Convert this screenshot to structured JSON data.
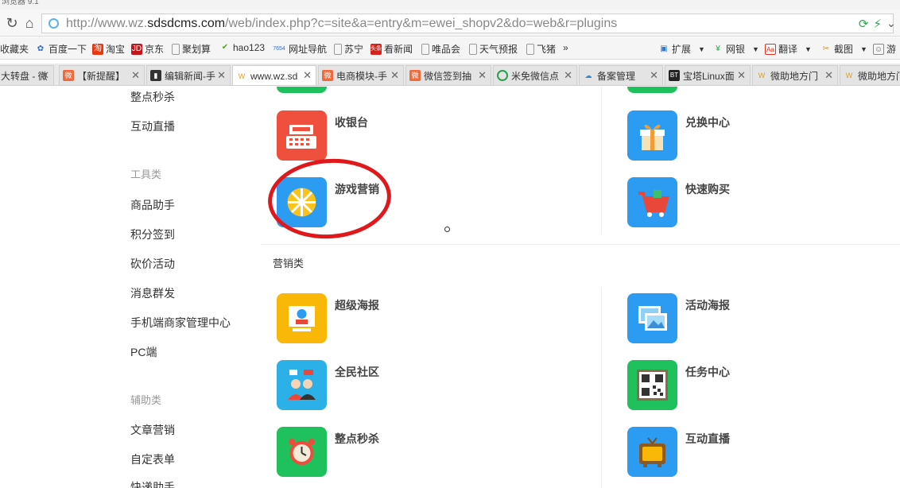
{
  "window": {
    "title": "浏览器 9.1"
  },
  "toolbar": {
    "refresh_label": "↻",
    "home_label": "⌂"
  },
  "address": {
    "pre": "http://www.wz.",
    "domain": "sdsdcms.com",
    "path": "/web/index.php?c=site&a=entry&m=ewei_shopv2&do=web&r=plugins"
  },
  "bookmarks": [
    {
      "label": "收藏夹",
      "icon": "star-icon"
    },
    {
      "label": "百度一下",
      "icon": "baidu-icon"
    },
    {
      "label": "淘宝",
      "icon": "taobao-icon"
    },
    {
      "label": "京东",
      "icon": "jd-icon"
    },
    {
      "label": "聚划算",
      "icon": "page-icon"
    },
    {
      "label": "hao123",
      "icon": "hao123-icon"
    },
    {
      "label": "网址导航",
      "icon": "nav-icon"
    },
    {
      "label": "苏宁",
      "icon": "page-icon"
    },
    {
      "label": "看新闻",
      "icon": "news-icon"
    },
    {
      "label": "唯品会",
      "icon": "page-icon"
    },
    {
      "label": "天气预报",
      "icon": "page-icon"
    },
    {
      "label": "飞猪",
      "icon": "page-icon"
    },
    {
      "label": "»",
      "icon": ""
    }
  ],
  "extensions": [
    {
      "label": "扩展",
      "icon": "puzzle-icon"
    },
    {
      "label": "网银",
      "icon": "bank-icon"
    },
    {
      "label": "翻译",
      "icon": "translate-icon"
    },
    {
      "label": "截图",
      "icon": "scissors-icon"
    },
    {
      "label": "游",
      "icon": "game-icon"
    }
  ],
  "tabs": [
    {
      "label": "大转盘 - 微",
      "icon": "page-icon"
    },
    {
      "label": "【新提醒】",
      "icon": "weiqing-icon"
    },
    {
      "label": "编辑新闻-手",
      "icon": "editor-icon"
    },
    {
      "label": "www.wz.sd",
      "icon": "site-icon"
    },
    {
      "label": "电商模块-手",
      "icon": "weiqing-icon"
    },
    {
      "label": "微信签到抽",
      "icon": "weiqing-icon"
    },
    {
      "label": "米免微信点",
      "icon": "check-icon"
    },
    {
      "label": "备案管理",
      "icon": "cloud-icon"
    },
    {
      "label": "宝塔Linux面",
      "icon": "bt-icon"
    },
    {
      "label": "微助地方门",
      "icon": "site-icon"
    },
    {
      "label": "微助地方门",
      "icon": "site-icon"
    }
  ],
  "sidebar": {
    "items_top": [
      "整点秒杀",
      "互动直播"
    ],
    "tools_header": "工具类",
    "tools": [
      "商品助手",
      "积分签到",
      "砍价活动",
      "消息群发",
      "手机端商家管理中心",
      "PC端"
    ],
    "aux_header": "辅助类",
    "aux": [
      "文章营销",
      "自定表单",
      "快递助手"
    ]
  },
  "section_marketing": {
    "title": "营销类"
  },
  "apps": {
    "cashier": {
      "name": "收银台",
      "icon": "cash-register-icon"
    },
    "exchange": {
      "name": "兑换中心",
      "icon": "gift-icon"
    },
    "game": {
      "name": "游戏营销",
      "icon": "wheel-icon"
    },
    "quickbuy": {
      "name": "快速购买",
      "icon": "cart-icon"
    },
    "poster": {
      "name": "超级海报",
      "icon": "poster-icon"
    },
    "actposter": {
      "name": "活动海报",
      "icon": "picture-icon"
    },
    "community": {
      "name": "全民社区",
      "icon": "community-icon"
    },
    "task": {
      "name": "任务中心",
      "icon": "qrcode-icon"
    },
    "seckill": {
      "name": "整点秒杀",
      "icon": "alarm-clock-icon"
    },
    "live": {
      "name": "互动直播",
      "icon": "tv-icon"
    }
  },
  "colors": {
    "blue_icon": "#2b9cf2",
    "green_icon": "#1fc15c",
    "yellow_icon": "#f9b708",
    "red_icon": "#ef4f3d",
    "annotation_red": "#e0171b"
  }
}
